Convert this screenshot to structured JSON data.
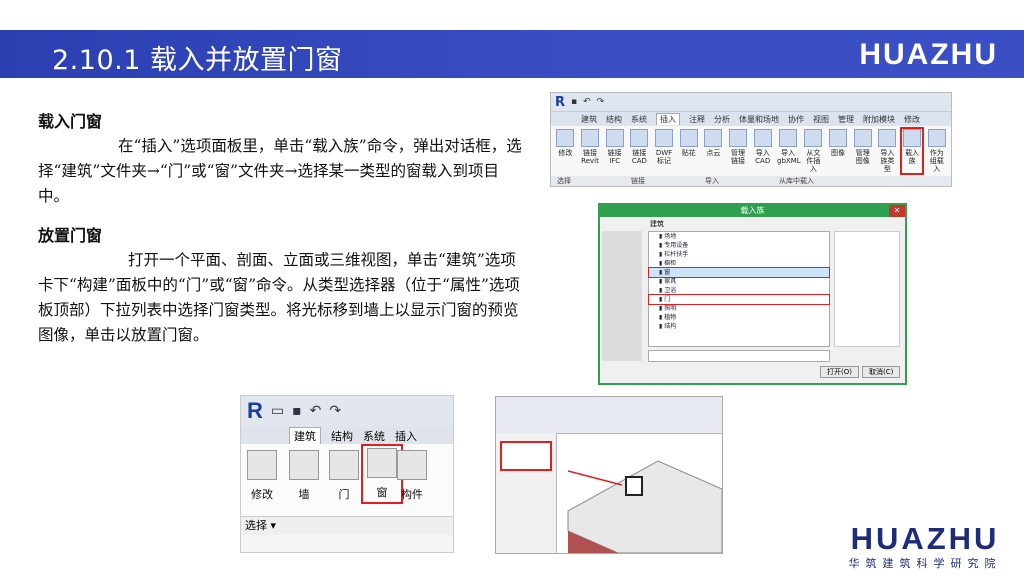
{
  "header": {
    "title": "2.10.1  载入并放置门窗",
    "logo": "HUAZHU"
  },
  "section_load": {
    "title": "载入门窗",
    "body": "在“插入”选项面板里，单击“载入族”命令，弹出对话框，选择“建筑”文件夹→“门”或“窗”文件夹→选择某一类型的窗载入到项目中。"
  },
  "section_place": {
    "title": "放置门窗",
    "body": "打开一个平面、剖面、立面或三维视图，单击“建筑”选项卡下“构建”面板中的“门”或“窗”命令。从类型选择器（位于“属性”选项板顶部）下拉列表中选择门窗类型。将光标移到墙上以显示门窗的预览图像，单击以放置门窗。"
  },
  "ribbon_shot": {
    "tabs": [
      "建筑",
      "结构",
      "系统",
      "插入",
      "注释",
      "分析",
      "体量和场地",
      "协作",
      "视图",
      "管理",
      "附加模块",
      "修改"
    ],
    "active_tab": "插入",
    "buttons": [
      "修改",
      "链接Revit",
      "链接IFC",
      "链接CAD",
      "DWF标记",
      "贴花",
      "点云",
      "管理链接",
      "导入CAD",
      "导入gbXML",
      "从文件插入",
      "图像",
      "管理图像",
      "导入族类型",
      "载入族",
      "作为组载入"
    ],
    "groups": [
      "选择",
      "链接",
      "导入",
      "从库中载入"
    ]
  },
  "dialog_shot": {
    "title": "载入族",
    "folder": "建筑",
    "items": [
      "场地",
      "专用设备",
      "栏杆扶手",
      "橱柜",
      "窗",
      "家具",
      "卫浴",
      "门",
      "照明",
      "植物",
      "结构"
    ],
    "open_label": "打开(O)",
    "cancel_label": "取消(C)"
  },
  "arch_shot": {
    "logo": "R",
    "tabs": [
      "建筑",
      "结构",
      "系统",
      "插入"
    ],
    "active_tab": "建筑",
    "buttons": [
      "修改",
      "墙",
      "门",
      "窗",
      "构件"
    ],
    "select_label": "选择"
  },
  "footer_logo": {
    "word": "HUAZHU",
    "sub": "华筑建筑科学研究院"
  }
}
